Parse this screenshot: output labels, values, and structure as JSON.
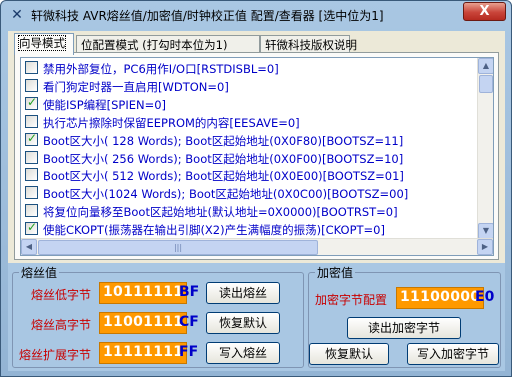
{
  "window": {
    "title": "轩微科技 AVR熔丝值/加密值/时钟校正值 配置/查看器 [选中位为1]",
    "close_label": "X"
  },
  "tabs": [
    {
      "label": "向导模式"
    },
    {
      "label": "位配置模式 (打勾时本位为1)"
    },
    {
      "label": "轩微科技版权说明"
    }
  ],
  "fuse_list": [
    {
      "label": "禁用外部复位，PC6用作I/O口[RSTDISBL=0]",
      "checked": false
    },
    {
      "label": "看门狗定时器一直启用[WDTON=0]",
      "checked": false
    },
    {
      "label": "使能ISP编程[SPIEN=0]",
      "checked": true
    },
    {
      "label": "执行芯片擦除时保留EEPROM的内容[EESAVE=0]",
      "checked": false
    },
    {
      "label": "Boot区大小( 128 Words); Boot区起始地址(0X0F80)[BOOTSZ=11]",
      "checked": true
    },
    {
      "label": "Boot区大小( 256 Words); Boot区起始地址(0X0F00)[BOOTSZ=10]",
      "checked": false
    },
    {
      "label": "Boot区大小( 512 Words); Boot区起始地址(0X0E00)[BOOTSZ=01]",
      "checked": false
    },
    {
      "label": "Boot区大小(1024 Words); Boot区起始地址(0X0C00)[BOOTSZ=00]",
      "checked": false
    },
    {
      "label": "将复位向量移至Boot区起始地址(默认地址=0X0000)[BOOTRST=0]",
      "checked": false
    },
    {
      "label": "使能CKOPT(振荡器在输出引脚(X2)产生满幅度的振荡)[CKOPT=0]",
      "checked": true
    }
  ],
  "fuse_group": {
    "title": "熔丝值",
    "low": {
      "label": "熔丝低字节",
      "bits": "10111111",
      "hex": "BF",
      "button": "读出熔丝"
    },
    "high": {
      "label": "熔丝高字节",
      "bits": "11001111",
      "hex": "CF",
      "button": "恢复默认"
    },
    "ext": {
      "label": "熔丝扩展字节",
      "bits": "11111111",
      "hex": "FF",
      "button": "写入熔丝"
    }
  },
  "lock_group": {
    "title": "加密值",
    "label": "加密字节配置",
    "bits": "11100000",
    "hex": "E0",
    "read_button": "读出加密字节",
    "default_button": "恢复默认",
    "write_button": "写入加密字节"
  },
  "colors": {
    "accent_orange": "#ff9900",
    "label_red": "#c80000",
    "hex_blue": "#0000c8",
    "check_green": "#21a121"
  }
}
